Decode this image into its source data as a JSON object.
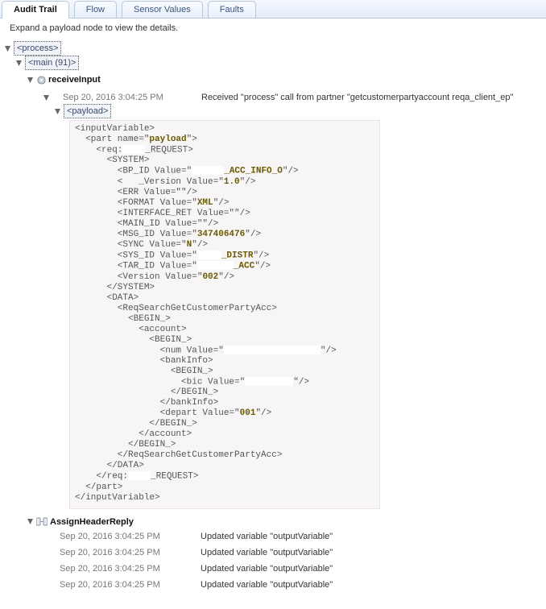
{
  "tabs": {
    "audit": "Audit Trail",
    "flow": "Flow",
    "sensor": "Sensor Values",
    "faults": "Faults"
  },
  "hint": "Expand a payload node to view the details.",
  "tree": {
    "process": "<process>",
    "main": "<main (91)>",
    "receiveInput": "receiveInput",
    "payload": "<payload>",
    "assignHeader": "AssignHeaderReply"
  },
  "receive": {
    "timestamp": "Sep 20, 2016 3:04:25 PM",
    "message": "Received \"process\" call from partner \"getcustomerpartyaccount    reqa_client_ep\""
  },
  "xml": {
    "l01": "<inputVariable>",
    "l02a": "  <part name=\"",
    "l02v": "payload",
    "l02b": "\">",
    "l03a": "    <req:",
    "l03b": "_REQUEST>",
    "l04": "      <SYSTEM>",
    "l05a": "        <BP_ID Value=\"",
    "l05v": "_ACC_INFO_O",
    "l05b": "\"/>",
    "l06a": "        <   _Version Value=\"",
    "l06v": "1.0",
    "l06b": "\"/>",
    "l07": "        <ERR Value=\"\"/>",
    "l08a": "        <FORMAT Value=\"",
    "l08v": "XML",
    "l08b": "\"/>",
    "l09": "        <INTERFACE_RET Value=\"\"/>",
    "l10": "        <MAIN_ID Value=\"\"/>",
    "l11a": "        <MSG_ID Value=\"",
    "l11v": "347406476",
    "l11b": "\"/>",
    "l12a": "        <SYNC Value=\"",
    "l12v": "N",
    "l12b": "\"/>",
    "l13a": "        <SYS_ID Value=\"",
    "l13v": "_DISTR",
    "l13b": "\"/>",
    "l14a": "        <TAR_ID Value=\"",
    "l14v": "_ACC",
    "l14b": "\"/>",
    "l15a": "        <Version Value=\"",
    "l15v": "002",
    "l15b": "\"/>",
    "l16": "      </SYSTEM>",
    "l17": "      <DATA>",
    "l18": "        <ReqSearchGetCustomerPartyAcc>",
    "l19": "          <BEGIN_>",
    "l20": "            <account>",
    "l21": "              <BEGIN_>",
    "l22a": "                <num Value=\"",
    "l22b": "\"/>",
    "l23": "                <bankInfo>",
    "l24": "                  <BEGIN_>",
    "l25a": "                    <bic Value=\"",
    "l25b": "\"/>",
    "l26": "                  </BEGIN_>",
    "l27": "                </bankInfo>",
    "l28a": "                <depart Value=\"",
    "l28v": "001",
    "l28b": "\"/>",
    "l29": "              </BEGIN_>",
    "l30": "            </account>",
    "l31": "          </BEGIN_>",
    "l32": "        </ReqSearchGetCustomerPartyAcc>",
    "l33": "      </DATA>",
    "l34a": "    </req:",
    "l34b": "_REQUEST>",
    "l35": "  </part>",
    "l36": "</inputVariable>"
  },
  "updates": {
    "ts": "Sep 20, 2016 3:04:25 PM",
    "msg": "Updated variable \"outputVariable\""
  }
}
